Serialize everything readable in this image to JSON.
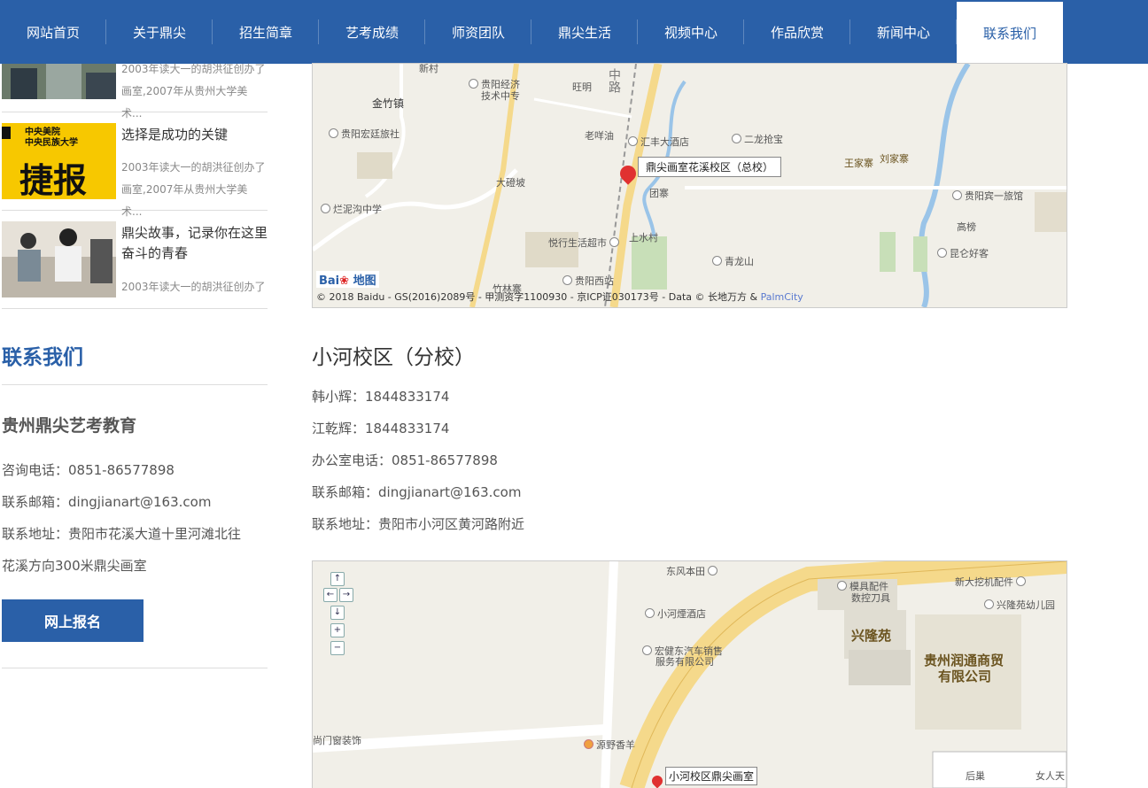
{
  "nav": {
    "items": [
      "网站首页",
      "关于鼎尖",
      "招生简章",
      "艺考成绩",
      "师资团队",
      "鼎尖生活",
      "视频中心",
      "作品欣赏",
      "新闻中心",
      "联系我们"
    ],
    "active": "联系我们"
  },
  "news": [
    {
      "title": "",
      "desc": [
        "2003年读大一的胡洪征创办了",
        "画室,2007年从贵州大学美术..."
      ]
    },
    {
      "title": "选择是成功的关键",
      "thumb_text": [
        "中央美院",
        "中央民族大学",
        "捷报"
      ],
      "desc": [
        "2003年读大一的胡洪征创办了",
        "画室,2007年从贵州大学美术..."
      ]
    },
    {
      "title": "鼎尖故事，记录你在这里奋斗的青春",
      "desc": [
        "2003年读大一的胡洪征创办了"
      ]
    }
  ],
  "sidebar_contact": {
    "heading": "联系我们",
    "org": "贵州鼎尖艺考教育",
    "phone": "咨询电话：0851-86577898",
    "email": "联系邮箱：dingjianart@163.com",
    "address_line1": "联系地址：贵阳市花溪大道十里河滩北往",
    "address_line2": "花溪方向300米鼎尖画室",
    "signup_button": "网上报名"
  },
  "map1": {
    "marker_label": "鼎尖画室花溪校区（总校）",
    "labels": {
      "jinzhu": "金竹镇",
      "guiyang_jingji": "贵阳经济",
      "jishu": "技术中专",
      "wangming": "旺明",
      "hongting": "贵阳宏廷旅社",
      "laoyang": "老咩油",
      "huifeng": "汇丰大酒店",
      "erlong": "二龙抢宝",
      "wangjiazhai": "王家寨",
      "liujiazhai": "刘家寨",
      "dazhaipo": "大磴坡",
      "tuanzhai": "团寨",
      "bingyihao": "贵阳宾一旅馆",
      "lanniguo": "烂泥沟中学",
      "gaobang": "高榜",
      "yueting": "悦行生活超市",
      "shangshuicun": "上水村",
      "qinglongshan": "青龙山",
      "kunlun": "昆仑好客",
      "zhulin": "竹林寨",
      "xizhan": "贵阳西站",
      "road": "中路",
      "xincun": "新村"
    },
    "copyright": "© 2018 Baidu - GS(2016)2089号 - 甲测资字1100930 - 京ICP证030173号 - Data © 长地万方 &",
    "copyright_link": "PalmCity",
    "logo": "Bai",
    "logo_suffix": "地图"
  },
  "campus2": {
    "title": "小河校区（分校）",
    "lines": [
      "韩小辉：1844833174",
      "江乾辉：1844833174",
      "办公室电话：0851-86577898",
      "联系邮箱：dingjianart@163.com",
      "联系地址：贵阳市小河区黄河路附近"
    ]
  },
  "map2": {
    "marker_label": "小河校区鼎尖画室",
    "controls": [
      "↑",
      "←",
      "→",
      "↓",
      "+",
      "−"
    ],
    "labels": {
      "dongfeng": "东风本田",
      "xiaohe_hotel": "小河煙酒店",
      "hongjian1": "宏健东汽车销售",
      "hongjian2": "服务有限公司",
      "mold1": "模具配件",
      "mold2": "数控刀具",
      "xinglongyuan": "兴隆苑",
      "runtong1": "贵州润通商贸",
      "runtong2": "有限公司",
      "xinda": "新大挖机配件",
      "xinglong_kg": "兴隆苑幼儿园",
      "shangmen": "尚门窗装饰",
      "yuanye": "源野香羊",
      "houchao": "后巢",
      "nvren": "女人天"
    }
  }
}
